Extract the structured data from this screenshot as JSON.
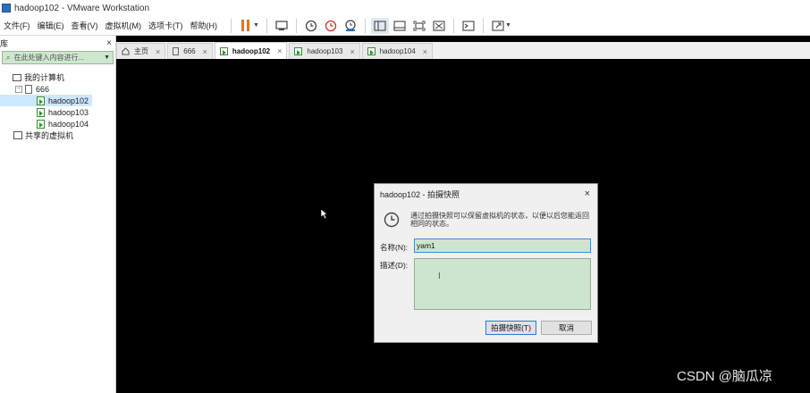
{
  "window": {
    "title": "hadoop102 - VMware Workstation"
  },
  "menu": [
    "文件(F)",
    "编辑(E)",
    "查看(V)",
    "虚拟机(M)",
    "选项卡(T)",
    "帮助(H)"
  ],
  "library": {
    "title": "库",
    "close": "×",
    "search_placeholder": "在此处键入内容进行...",
    "tree": [
      {
        "label": "我的计算机",
        "level": 0
      },
      {
        "label": "666",
        "level": 1
      },
      {
        "label": "hadoop102",
        "level": 2,
        "selected": true
      },
      {
        "label": "hadoop103",
        "level": 2
      },
      {
        "label": "hadoop104",
        "level": 2
      },
      {
        "label": "共享的虚拟机",
        "level": 0
      }
    ]
  },
  "tabs": [
    {
      "label": "主页",
      "icon": "home-icon"
    },
    {
      "label": "666",
      "icon": "doc-icon"
    },
    {
      "label": "hadoop102",
      "icon": "vm-icon",
      "active": true
    },
    {
      "label": "hadoop103",
      "icon": "vm-icon"
    },
    {
      "label": "hadoop104",
      "icon": "vm-icon"
    }
  ],
  "tab_close": "×",
  "dialog": {
    "title": "hadoop102 - 拍摄快照",
    "close": "×",
    "message": "通过拍摄快照可以保留虚拟机的状态，以便以后您能返回相同的状态。",
    "name_label": "名称(N):",
    "name_value": "yam1",
    "desc_label": "描述(D):",
    "desc_value": "",
    "ok_label": "拍摄快照(T)",
    "cancel_label": "取消"
  },
  "watermark": "CSDN @脑瓜凉",
  "colors": {
    "accent": "#e8731a",
    "field_bg": "#cfe4cf",
    "focus_border": "#3d8ad6"
  }
}
